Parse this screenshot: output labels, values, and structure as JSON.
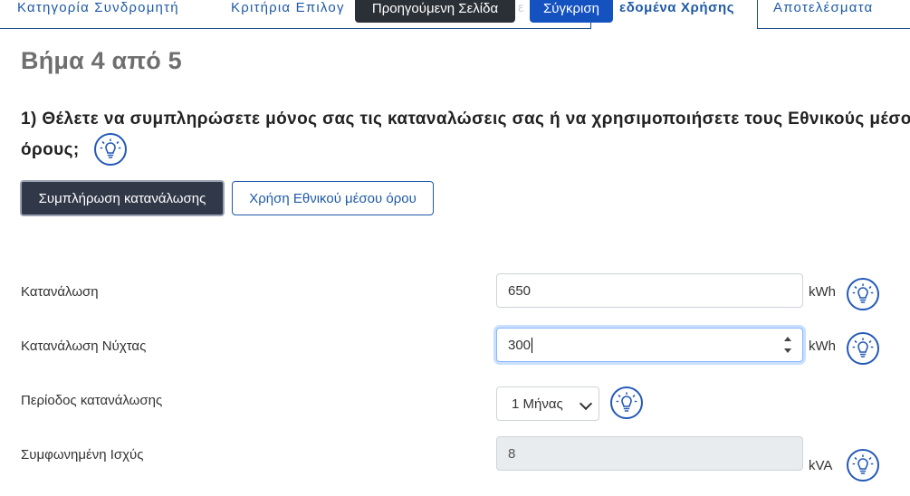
{
  "tabs": {
    "tab1_label": "Κατηγορία Συνδρομητή",
    "tab2_label": "Κριτήρια Επιλογ",
    "tab3_partial": "ε",
    "tab4_label": "εδομένα Χρήσης",
    "tab5_label": "Αποτελέσματα"
  },
  "top_buttons": {
    "previous_label": "Προηγούμενη Σελίδα",
    "compare_label": "Σύγκριση"
  },
  "step": {
    "title": "Βήμα 4 από 5"
  },
  "question": {
    "line1": "1) Θέλετε να συμπληρώσετε μόνος σας τις καταναλώσεις σας ή να χρησιμοποιήσετε τους Εθνικούς μέσους",
    "line2": "όρους;"
  },
  "choice_buttons": {
    "fill_label": "Συμπλήρωση κατανάλωσης",
    "national_label": "Χρήση Εθνικού μέσου όρου"
  },
  "form": {
    "consumption": {
      "label": "Κατανάλωση",
      "value": "650",
      "unit": "kWh"
    },
    "night_consumption": {
      "label": "Κατανάλωση Νύχτας",
      "value": "300",
      "unit": "kWh"
    },
    "period": {
      "label": "Περίοδος κατανάλωσης",
      "selected": "1 Μήνας"
    },
    "agreed_power": {
      "label": "Συμφωνημένη Ισχύς",
      "value": "8",
      "unit": "kVA"
    }
  },
  "icons": {
    "hint": "lightbulb-icon"
  },
  "colors": {
    "primary_blue": "#1f5aa6",
    "dark_button": "#313848",
    "compare_blue": "#1452c0"
  }
}
